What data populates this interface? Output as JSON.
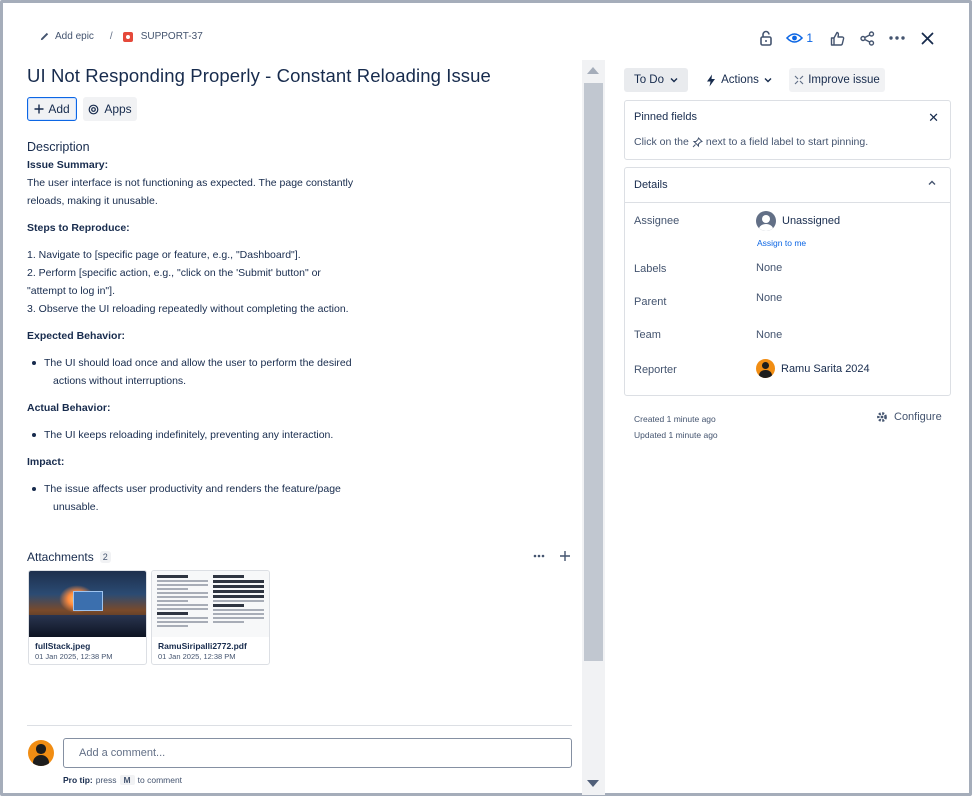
{
  "breadcrumb": {
    "epic_label": "Add epic",
    "separator": "/",
    "issue_key": "SUPPORT-37"
  },
  "top_actions": {
    "watch_count": "1"
  },
  "issue": {
    "title": "UI Not Responding Properly - Constant Reloading Issue"
  },
  "toolbar": {
    "add_label": "Add",
    "apps_label": "Apps"
  },
  "description": {
    "heading": "Description",
    "summary_heading": "Issue Summary:",
    "summary_line1": "The user interface is not functioning as expected. The page constantly",
    "summary_line2": "reloads, making it unusable.",
    "steps_heading": "Steps to Reproduce:",
    "step1": "1. Navigate to [specific page or feature, e.g., \"Dashboard\"].",
    "step2_line1": "2. Perform [specific action, e.g., \"click on the 'Submit' button\" or",
    "step2_line2": "\"attempt to log in\"].",
    "step3": "3. Observe the UI reloading repeatedly without completing the action.",
    "expected_heading": "Expected Behavior:",
    "expected_line1": "The UI should load once and allow the user to perform the desired",
    "expected_line2": "actions without interruptions.",
    "actual_heading": "Actual Behavior:",
    "actual_line1": "The UI keeps reloading indefinitely, preventing any interaction.",
    "impact_heading": "Impact:",
    "impact_line1": "The issue affects user productivity and renders the feature/page",
    "impact_line2": "unusable."
  },
  "attachments": {
    "heading": "Attachments",
    "count": "2",
    "items": [
      {
        "name": "fullStack.jpeg",
        "date": "01 Jan 2025, 12:38 PM"
      },
      {
        "name": "RamuSiripalli2772.pdf",
        "date": "01 Jan 2025, 12:38 PM"
      }
    ]
  },
  "comment": {
    "placeholder": "Add a comment...",
    "protip_label": "Pro tip:",
    "protip_press": "press",
    "protip_key": "M",
    "protip_suffix": "to comment"
  },
  "status": {
    "label": "To Do"
  },
  "actions_label": "Actions",
  "improve_label": "Improve issue",
  "pinned": {
    "heading": "Pinned fields",
    "hint_before": "Click on the",
    "hint_after": "next to a field label to start pinning."
  },
  "details": {
    "heading": "Details",
    "assignee_label": "Assignee",
    "assignee_value": "Unassigned",
    "assign_to_me": "Assign to me",
    "labels_label": "Labels",
    "labels_value": "None",
    "parent_label": "Parent",
    "parent_value": "None",
    "team_label": "Team",
    "team_value": "None",
    "reporter_label": "Reporter",
    "reporter_value": "Ramu Sarita 2024"
  },
  "meta": {
    "created": "Created 1 minute ago",
    "updated": "Updated 1 minute ago",
    "configure_label": "Configure"
  },
  "colors": {
    "link": "#0c66e4",
    "text": "#172b4d",
    "subtle": "#44546f",
    "issue_type": "#e5493a",
    "avatar": "#f18d13"
  },
  "icons": [
    "pencil-icon",
    "issue-type-icon",
    "lock-icon",
    "eye-icon",
    "thumbs-up-icon",
    "share-icon",
    "more-icon",
    "close-icon",
    "plus-icon",
    "apps-icon",
    "chevron-down-icon",
    "lightning-icon",
    "sparkle-icon",
    "pin-icon",
    "chevron-up-icon",
    "gear-icon"
  ]
}
